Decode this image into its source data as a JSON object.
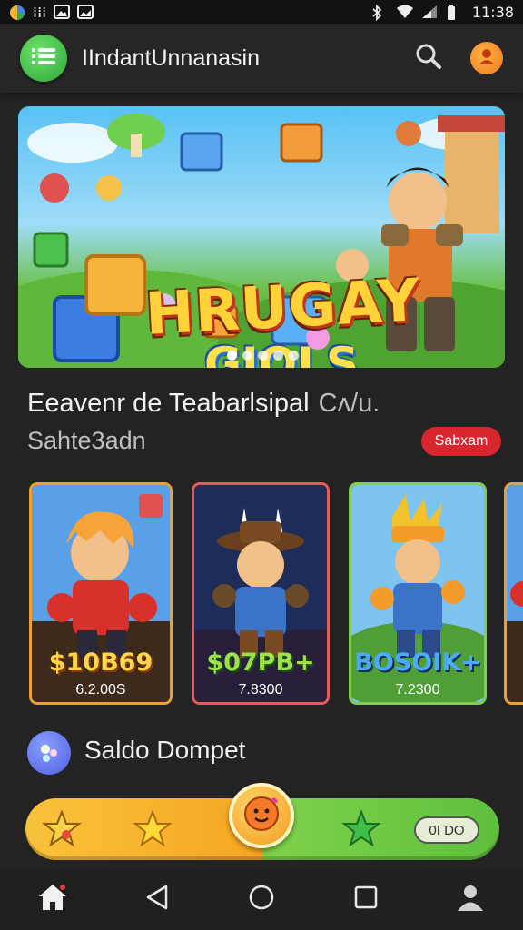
{
  "status_bar": {
    "left_text": "⁞⁞⁞",
    "time": "11:38"
  },
  "app_bar": {
    "title": "IIndant​Unnanasin",
    "icons": [
      "menu-icon",
      "search-icon",
      "profile-icon"
    ]
  },
  "banner": {
    "title": "HRUGAY",
    "subtitle": "GIOLS",
    "slide_count": 5,
    "active_slide": 0
  },
  "section": {
    "title": "Eeavenr de Teabarlsipal",
    "title_extra": "Cʌ/u.",
    "subtitle": "Sahte3adn",
    "see_all_label": "Sabxam"
  },
  "cards": [
    {
      "price": "$10B69",
      "stat": "6.2.00S",
      "price_color": "#ffd54a",
      "border": "#f0a030"
    },
    {
      "price": "$07PB+",
      "stat": "7.8300",
      "price_color": "#9be24a",
      "border": "#e85a5a"
    },
    {
      "price": "BOSOIK+",
      "stat": "7.2300",
      "price_color": "#4aa8ff",
      "border": "#7fcf4f"
    }
  ],
  "wallet": {
    "label": "Saldo Dompet"
  },
  "reward_bar": {
    "value_label": "0I DO",
    "icons": [
      "star-badge-icon",
      "star-icon",
      "coin-face-icon",
      "green-star-icon"
    ]
  },
  "bottom_nav": {
    "items": [
      "home-icon",
      "back-icon",
      "home-circle-icon",
      "recents-icon",
      "person-icon"
    ]
  },
  "colors": {
    "background": "#232323",
    "accent_green": "#2fa539",
    "accent_red": "#d8262f",
    "accent_orange": "#f2791d"
  }
}
